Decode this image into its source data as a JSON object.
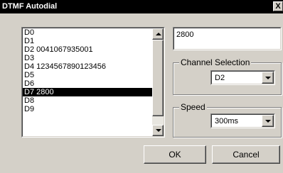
{
  "window": {
    "title": "DTMF Autodial",
    "close_label": "X"
  },
  "dial_list": {
    "items": [
      {
        "label": "D0"
      },
      {
        "label": "D1"
      },
      {
        "label": "D2 0041067935001"
      },
      {
        "label": "D3"
      },
      {
        "label": "D4 1234567890123456"
      },
      {
        "label": "D5"
      },
      {
        "label": "D6"
      },
      {
        "label": "D7 2800",
        "selected": true
      },
      {
        "label": "D8"
      },
      {
        "label": "D9"
      }
    ],
    "selected_index": 7
  },
  "number_field": {
    "value": "2800"
  },
  "channel_selection": {
    "label": "Channel Selection",
    "value": "D2"
  },
  "speed": {
    "label": "Speed",
    "value": "300ms"
  },
  "buttons": {
    "ok": "OK",
    "cancel": "Cancel"
  },
  "colors": {
    "dialog_bg": "#d4d0c8",
    "titlebar_bg": "#000000",
    "selection_bg": "#000000"
  },
  "icons": [
    "close-icon",
    "scroll-up-icon",
    "scroll-down-icon",
    "dropdown-arrow-icon"
  ]
}
